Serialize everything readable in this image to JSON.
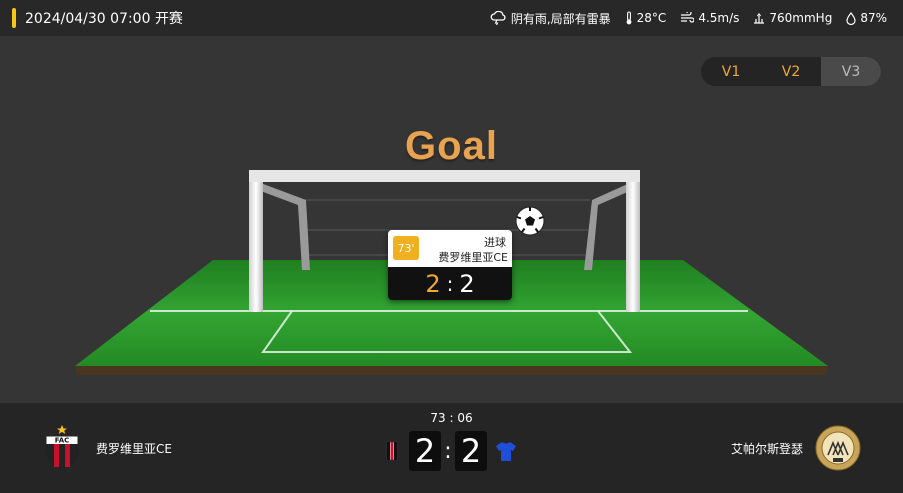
{
  "header": {
    "kickoff": "2024/04/30 07:00 开赛",
    "weather": {
      "condition": "阴有雨,局部有雷暴",
      "temperature": "28°C",
      "wind": "4.5m/s",
      "pressure": "760mmHg",
      "humidity": "87%"
    }
  },
  "view_tabs": [
    "V1",
    "V2",
    "V3"
  ],
  "animation": {
    "title": "Goal",
    "event": {
      "minute": "73'",
      "type": "进球",
      "team": "费罗维里亚CE",
      "score_home": "2",
      "score_separator": ":",
      "score_away": "2"
    }
  },
  "match": {
    "clock": "73 : 06",
    "home": {
      "name": "费罗维里亚CE",
      "score": "2",
      "crest_text": "FAC"
    },
    "away": {
      "name": "艾帕尔斯登瑟",
      "score": "2"
    },
    "score_separator": ":"
  },
  "colors": {
    "accent": "#f5c518",
    "goal_title": "#e8a350",
    "tab_active": "#f0a830",
    "pitch": "#2e9a2e"
  }
}
